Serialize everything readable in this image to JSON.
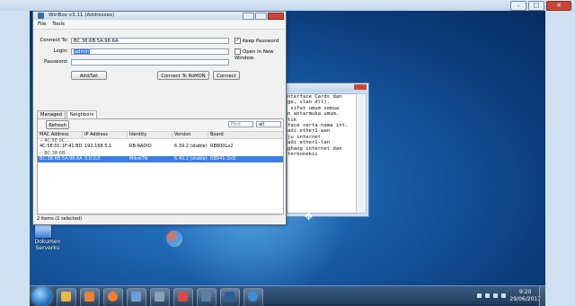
{
  "outer_window": {
    "ctrl_minimize": "–",
    "ctrl_maximize": "□",
    "ctrl_close": "✕"
  },
  "desktop": {
    "icon_label": "Dokumen\nServerku"
  },
  "taskbar": {
    "items": [
      "explorer-icon",
      "media-player-icon",
      "firefox-icon",
      "app-icon",
      "app-icon",
      "app-icon",
      "app-icon",
      "app-icon",
      "winbox-icon"
    ],
    "clock_time": "9:20",
    "clock_date": "29/06/2017"
  },
  "winbox": {
    "title": "WinBox v3.11 (Addresses)",
    "menu": [
      "File",
      "Tools"
    ],
    "connect_to_label": "Connect To:",
    "connect_to_value": "BC:38:6B:5A:96:6A",
    "login_label": "Login:",
    "login_value": "admin",
    "password_label": "Password:",
    "password_value": "",
    "keep_password_label": "Keep Password",
    "keep_password_checked": true,
    "open_new_window_label": "Open In New Window",
    "open_new_window_checked": false,
    "add_set_label": "Add/Set",
    "connect_romon_label": "Connect To RoMON",
    "connect_label": "Connect",
    "tabs": [
      "Managed",
      "Neighbors"
    ],
    "active_tab": "Neighbors",
    "refresh_label": "Refresh",
    "find_placeholder": "Find",
    "filter_value": "all",
    "columns": [
      "MAC Address",
      "IP Address",
      "Identity",
      "Version",
      "Board"
    ],
    "rows": [
      {
        "type": "group",
        "mac": "-- 4C:5E:0C..."
      },
      {
        "type": "item",
        "mac": "4C:5E:0C:1F:41:BD",
        "ip": "192.168.5.1",
        "identity": "RB-RADIO",
        "version": "6.39.2 (stable)",
        "board": "RB800Lx2"
      },
      {
        "type": "group",
        "mac": "-- BC:38:6B..."
      },
      {
        "type": "item",
        "mac": "BC:38:6B:5A:96:6A",
        "ip": "0.0.0.0",
        "identity": "MikroTik",
        "version": "6.40.2 (stable)",
        "board": "RB941-2nD",
        "selected": true
      }
    ],
    "status_text": "2 items (1 selected)"
  },
  "notepad": {
    "lines": [
      "",
      "",
      "",
      "",
      "nterface Cards dan",
      "ge, vlan dll).",
      " sifat umum semua",
      "n antarmuka umum.",
      "",
      "",
      "tik",
      "face serta nama int.",
      "",
      "",
      "adi ether1-wan",
      "ju internet",
      "",
      "",
      "adi ether1-lan",
      "ghang internet dan",
      "terkoneksi"
    ]
  }
}
